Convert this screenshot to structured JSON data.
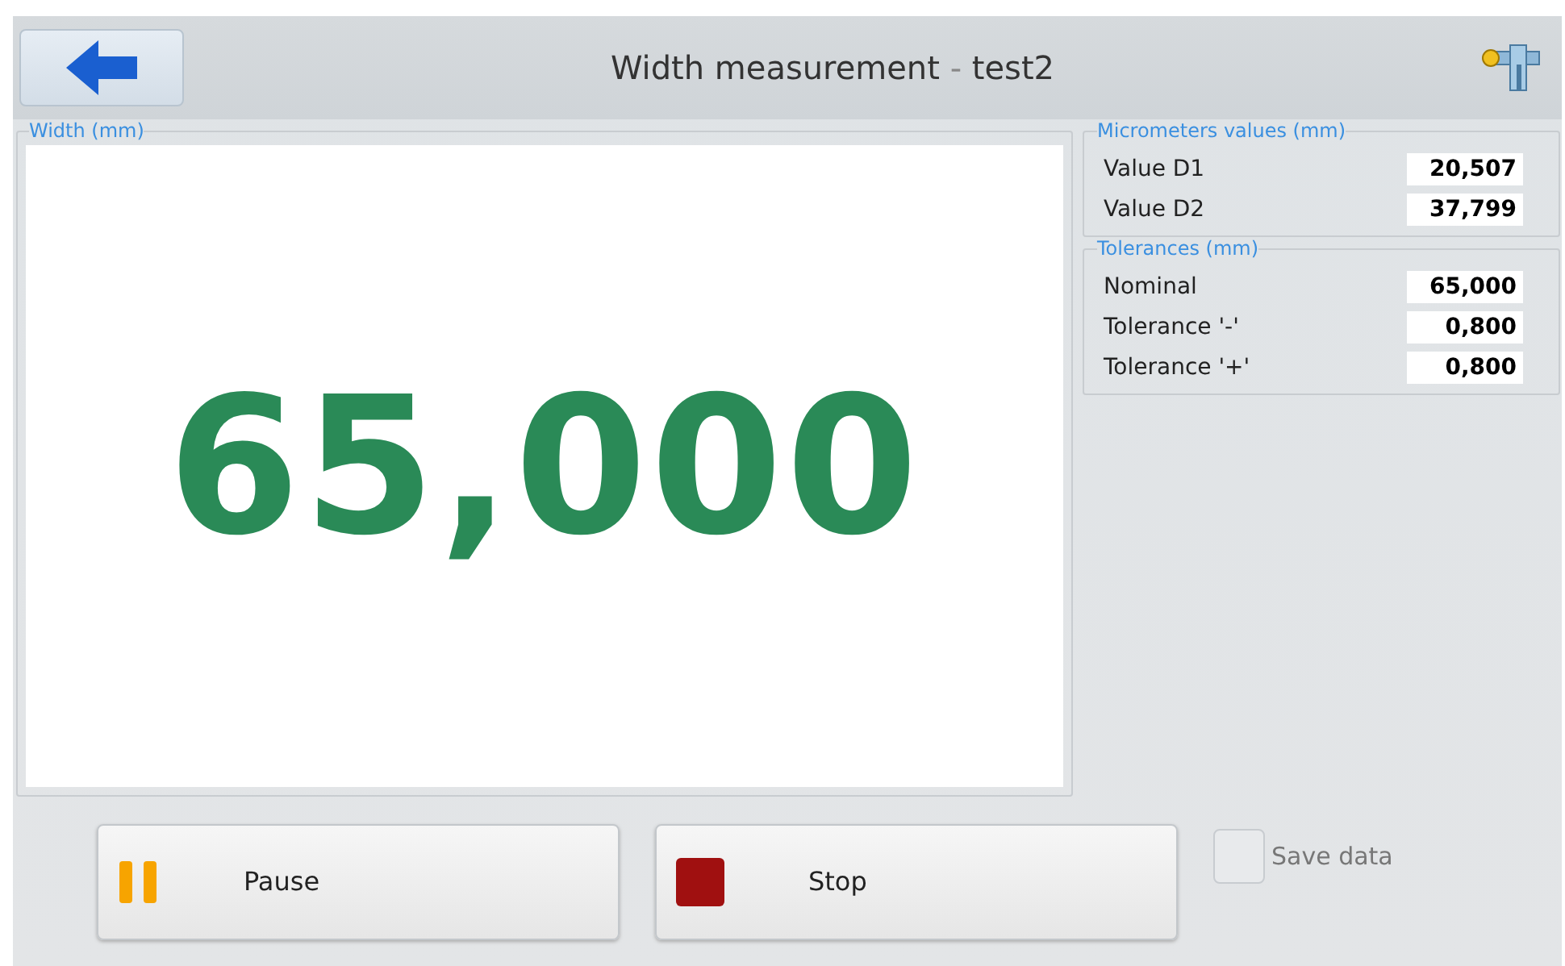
{
  "header": {
    "title": "Width measurement",
    "separator": "-",
    "subtitle": "test2"
  },
  "width_panel": {
    "legend": "Width (mm)",
    "value": "65,000"
  },
  "micrometers": {
    "legend": "Micrometers values (mm)",
    "rows": [
      {
        "label": "Value D1",
        "value": "20,507"
      },
      {
        "label": "Value D2",
        "value": "37,799"
      }
    ]
  },
  "tolerances": {
    "legend": "Tolerances (mm)",
    "rows": [
      {
        "label": "Nominal",
        "value": "65,000"
      },
      {
        "label": "Tolerance '-'",
        "value": "0,800"
      },
      {
        "label": "Tolerance '+'",
        "value": "0,800"
      }
    ]
  },
  "buttons": [
    {
      "kind": "pause",
      "label": "Pause"
    },
    {
      "kind": "stop",
      "label": "Stop"
    }
  ],
  "save_data": {
    "label": "Save data",
    "checked": false
  }
}
